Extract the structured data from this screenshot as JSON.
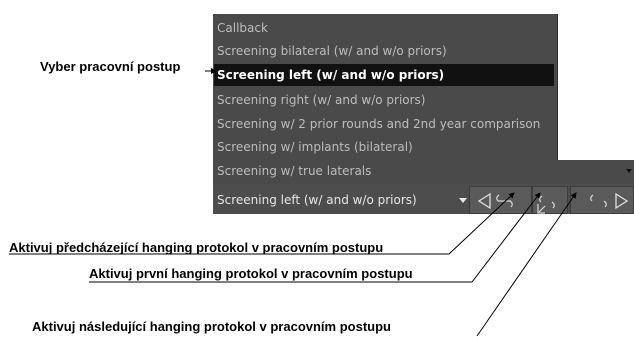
{
  "dropdown": {
    "items": [
      {
        "label": "Callback"
      },
      {
        "label": "Screening bilateral (w/ and w/o priors)"
      },
      {
        "label": "Screening left (w/ and w/o priors)",
        "selected": true
      },
      {
        "label": "Screening right (w/ and w/o priors)"
      },
      {
        "label": "Screening w/ 2 prior rounds and 2nd year comparison"
      },
      {
        "label": "Screening w/ implants (bilateral)"
      },
      {
        "label": "Screening w/ true laterals"
      }
    ]
  },
  "select": {
    "value": "Screening left (w/ and w/o priors)"
  },
  "nav_buttons": {
    "previous_icon": "previous-hanging-icon",
    "first_icon": "first-hanging-icon",
    "next_icon": "next-hanging-icon"
  },
  "annotations": {
    "choose_workflow": "Vyber pracovní postup",
    "activate_previous": "Aktivuj předcházející hanging protokol v pracovním postupu",
    "activate_first": "Aktivuj první hanging protokol v pracovním postupu",
    "activate_next": "Aktivuj následující hanging protokol v pracovním postupu"
  },
  "colors": {
    "panel": "#4a4a4a",
    "selected_row": "#111111",
    "item_text": "#bdbdbd",
    "selected_text": "#ffffff"
  }
}
